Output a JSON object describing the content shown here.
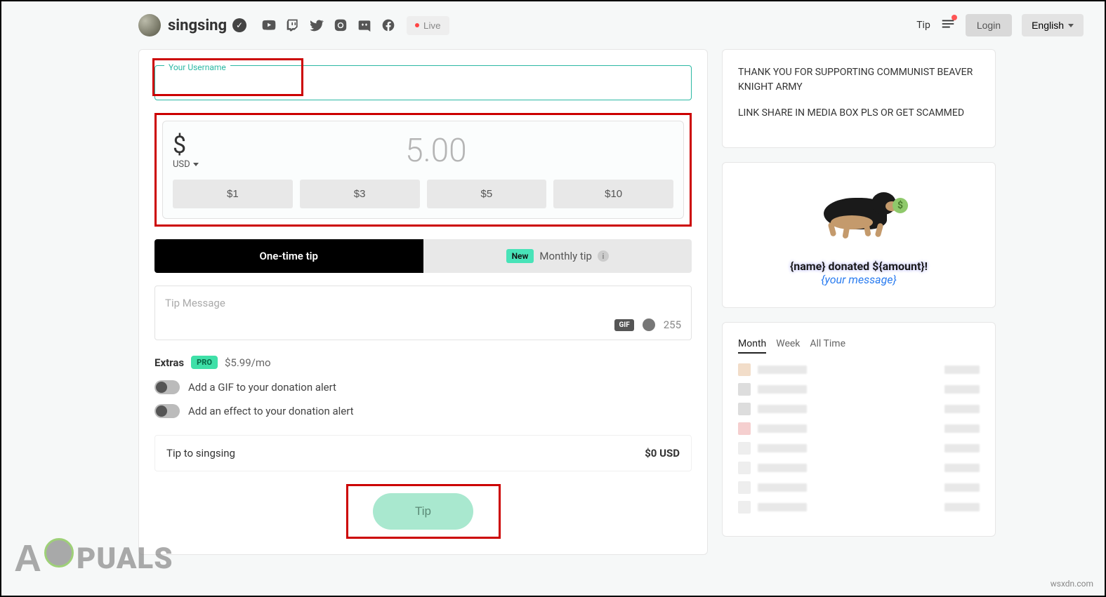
{
  "header": {
    "streamer": "singsing",
    "live": "Live",
    "tip": "Tip",
    "login": "Login",
    "language": "English"
  },
  "form": {
    "username_label": "Your Username",
    "username_value": "",
    "currency_symbol": "$",
    "currency_code": "USD",
    "amount": "5.00",
    "presets": [
      "$1",
      "$3",
      "$5",
      "$10"
    ],
    "onetime": "One-time tip",
    "monthly": "Monthly tip",
    "new_badge": "New",
    "msg_placeholder": "Tip Message",
    "char_count": "255",
    "extras_label": "Extras",
    "pro": "PRO",
    "extras_price": "$5.99/mo",
    "toggle_gif": "Add a GIF to your donation alert",
    "toggle_effect": "Add an effect to your donation alert",
    "summary_label": "Tip to singsing",
    "summary_amount": "$0 USD",
    "tip_button": "Tip"
  },
  "thankyou": {
    "line1": "THANK YOU FOR SUPPORTING COMMUNIST BEAVER KNIGHT ARMY",
    "line2": "LINK SHARE IN MEDIA BOX PLS OR GET SCAMMED"
  },
  "alert": {
    "name_line": "{name} donated ${amount}!",
    "msg_line": "{your message}"
  },
  "leaderboard": {
    "tabs": [
      "Month",
      "Week",
      "All Time"
    ]
  },
  "watermark": {
    "brand_a": "A",
    "brand_rest": "PUALS",
    "site": "wsxdn.com"
  }
}
